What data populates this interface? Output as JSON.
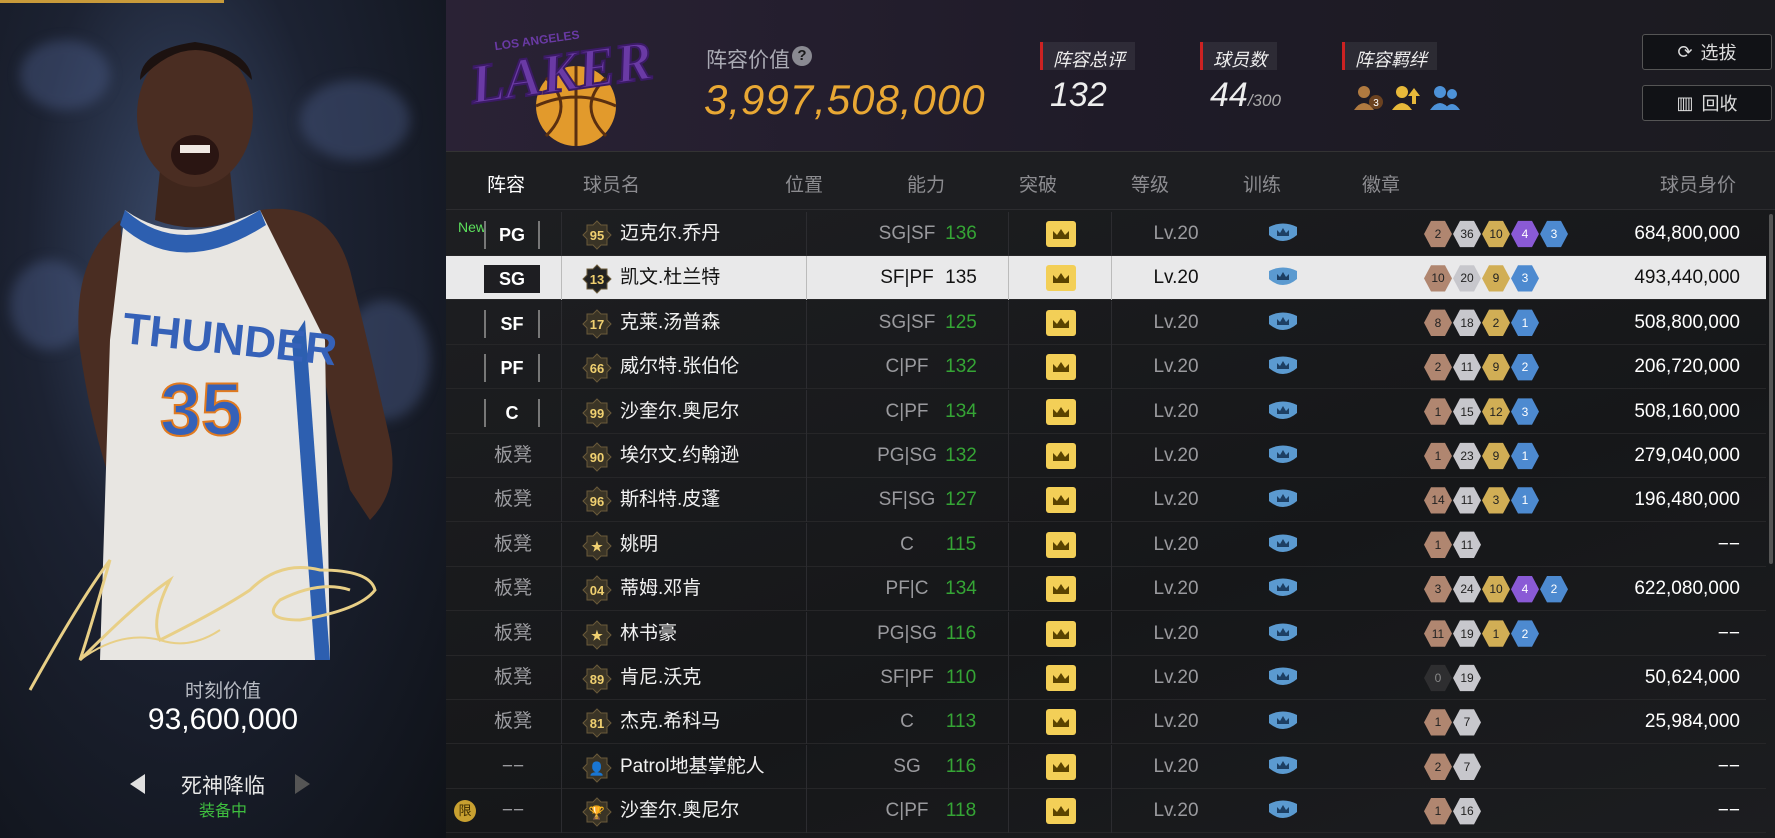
{
  "left_panel": {
    "moment_label": "时刻价值",
    "moment_value": "93,600,000",
    "skin_name": "死神降临",
    "skin_status": "装备中",
    "jersey_text": "THUNDER",
    "jersey_number": "35"
  },
  "header": {
    "team_logo_text": "LAKERS",
    "team_logo_top_text": "LOS ANGELES",
    "lineup_value_label": "阵容价值",
    "lineup_value": "3,997,508,000",
    "help": "?",
    "rating_label": "阵容总评",
    "rating_value": "132",
    "players_label": "球员数",
    "players_value": "44",
    "players_max": "/300",
    "bond_label": "阵容羁绊",
    "bonds": [
      "3",
      "",
      ""
    ],
    "scout_button": "选拔",
    "recycle_button": "回收"
  },
  "columns": [
    "阵容",
    "球员名",
    "位置",
    "能力",
    "突破",
    "等级",
    "训练",
    "徽章",
    "球员身价"
  ],
  "rows": [
    {
      "slot": "PG",
      "new": "New",
      "jersey": "95",
      "name": "迈克尔.乔丹",
      "position": "SG|SF",
      "ability": "136",
      "level": "Lv.20",
      "badges": [
        [
          "bronze",
          "2"
        ],
        [
          "silver",
          "36"
        ],
        [
          "gold",
          "10"
        ],
        [
          "purple",
          "4"
        ],
        [
          "blue",
          "3"
        ]
      ],
      "value": "684,800,000"
    },
    {
      "slot": "SG",
      "jersey": "13",
      "name": "凯文.杜兰特",
      "position": "SF|PF",
      "ability": "135",
      "level": "Lv.20",
      "badges": [
        [
          "bronze",
          "10"
        ],
        [
          "silver",
          "20"
        ],
        [
          "gold",
          "9"
        ],
        [
          "blue",
          "3"
        ]
      ],
      "value": "493,440,000",
      "selected": true
    },
    {
      "slot": "SF",
      "jersey": "17",
      "name": "克莱.汤普森",
      "position": "SG|SF",
      "ability": "125",
      "level": "Lv.20",
      "badges": [
        [
          "bronze",
          "8"
        ],
        [
          "silver",
          "18"
        ],
        [
          "gold",
          "2"
        ],
        [
          "blue",
          "1"
        ]
      ],
      "value": "508,800,000"
    },
    {
      "slot": "PF",
      "jersey": "66",
      "name": "威尔特.张伯伦",
      "position": "C|PF",
      "ability": "132",
      "level": "Lv.20",
      "badges": [
        [
          "bronze",
          "2"
        ],
        [
          "silver",
          "11"
        ],
        [
          "gold",
          "9"
        ],
        [
          "blue",
          "2"
        ]
      ],
      "value": "206,720,000"
    },
    {
      "slot": "C",
      "jersey": "99",
      "name": "沙奎尔.奥尼尔",
      "position": "C|PF",
      "ability": "134",
      "level": "Lv.20",
      "badges": [
        [
          "bronze",
          "1"
        ],
        [
          "silver",
          "15"
        ],
        [
          "gold",
          "12"
        ],
        [
          "blue",
          "3"
        ]
      ],
      "value": "508,160,000"
    },
    {
      "slot": "板凳",
      "jersey": "90",
      "name": "埃尔文.约翰逊",
      "position": "PG|SG",
      "ability": "132",
      "level": "Lv.20",
      "badges": [
        [
          "bronze",
          "1"
        ],
        [
          "silver",
          "23"
        ],
        [
          "gold",
          "9"
        ],
        [
          "blue",
          "1"
        ]
      ],
      "value": "279,040,000"
    },
    {
      "slot": "板凳",
      "jersey": "96",
      "name": "斯科特.皮蓬",
      "position": "SF|SG",
      "ability": "127",
      "level": "Lv.20",
      "badges": [
        [
          "bronze",
          "14"
        ],
        [
          "silver",
          "11"
        ],
        [
          "gold",
          "3"
        ],
        [
          "blue",
          "1"
        ]
      ],
      "value": "196,480,000"
    },
    {
      "slot": "板凳",
      "jersey": "★",
      "name": "姚明",
      "position": "C",
      "ability": "115",
      "level": "Lv.20",
      "badges": [
        [
          "bronze",
          "1"
        ],
        [
          "silver",
          "11"
        ]
      ],
      "value": "−−"
    },
    {
      "slot": "板凳",
      "jersey": "04",
      "name": "蒂姆.邓肯",
      "position": "PF|C",
      "ability": "134",
      "level": "Lv.20",
      "badges": [
        [
          "bronze",
          "3"
        ],
        [
          "silver",
          "24"
        ],
        [
          "gold",
          "10"
        ],
        [
          "purple",
          "4"
        ],
        [
          "blue",
          "2"
        ]
      ],
      "value": "622,080,000"
    },
    {
      "slot": "板凳",
      "jersey": "★",
      "name": "林书豪",
      "position": "PG|SG",
      "ability": "116",
      "level": "Lv.20",
      "badges": [
        [
          "bronze",
          "11"
        ],
        [
          "silver",
          "19"
        ],
        [
          "gold",
          "1"
        ],
        [
          "blue",
          "2"
        ]
      ],
      "value": "−−"
    },
    {
      "slot": "板凳",
      "jersey": "89",
      "name": "肯尼.沃克",
      "position": "SF|PF",
      "ability": "110",
      "level": "Lv.20",
      "badges": [
        [
          "black",
          "0"
        ],
        [
          "silver",
          "19"
        ]
      ],
      "value": "50,624,000"
    },
    {
      "slot": "板凳",
      "jersey": "81",
      "name": "杰克.希科马",
      "position": "C",
      "ability": "113",
      "level": "Lv.20",
      "badges": [
        [
          "bronze",
          "1"
        ],
        [
          "silver",
          "7"
        ]
      ],
      "value": "25,984,000"
    },
    {
      "slot": "−−",
      "jersey": "👤",
      "name": "Patrol地基掌舵人",
      "position": "SG",
      "ability": "116",
      "level": "Lv.20",
      "badges": [
        [
          "bronze",
          "2"
        ],
        [
          "silver",
          "7"
        ]
      ],
      "value": "−−"
    },
    {
      "slot": "−−",
      "limited": "限",
      "jersey": "🏆",
      "name": "沙奎尔.奥尼尔",
      "position": "C|PF",
      "ability": "118",
      "level": "Lv.20",
      "badges": [
        [
          "bronze",
          "1"
        ],
        [
          "silver",
          "16"
        ]
      ],
      "value": "−−"
    }
  ],
  "colors": {
    "accent_gold": "#e9a834",
    "ability_green": "#35a535",
    "crown": "#f3cf57",
    "shield": "#5b9ad0"
  }
}
